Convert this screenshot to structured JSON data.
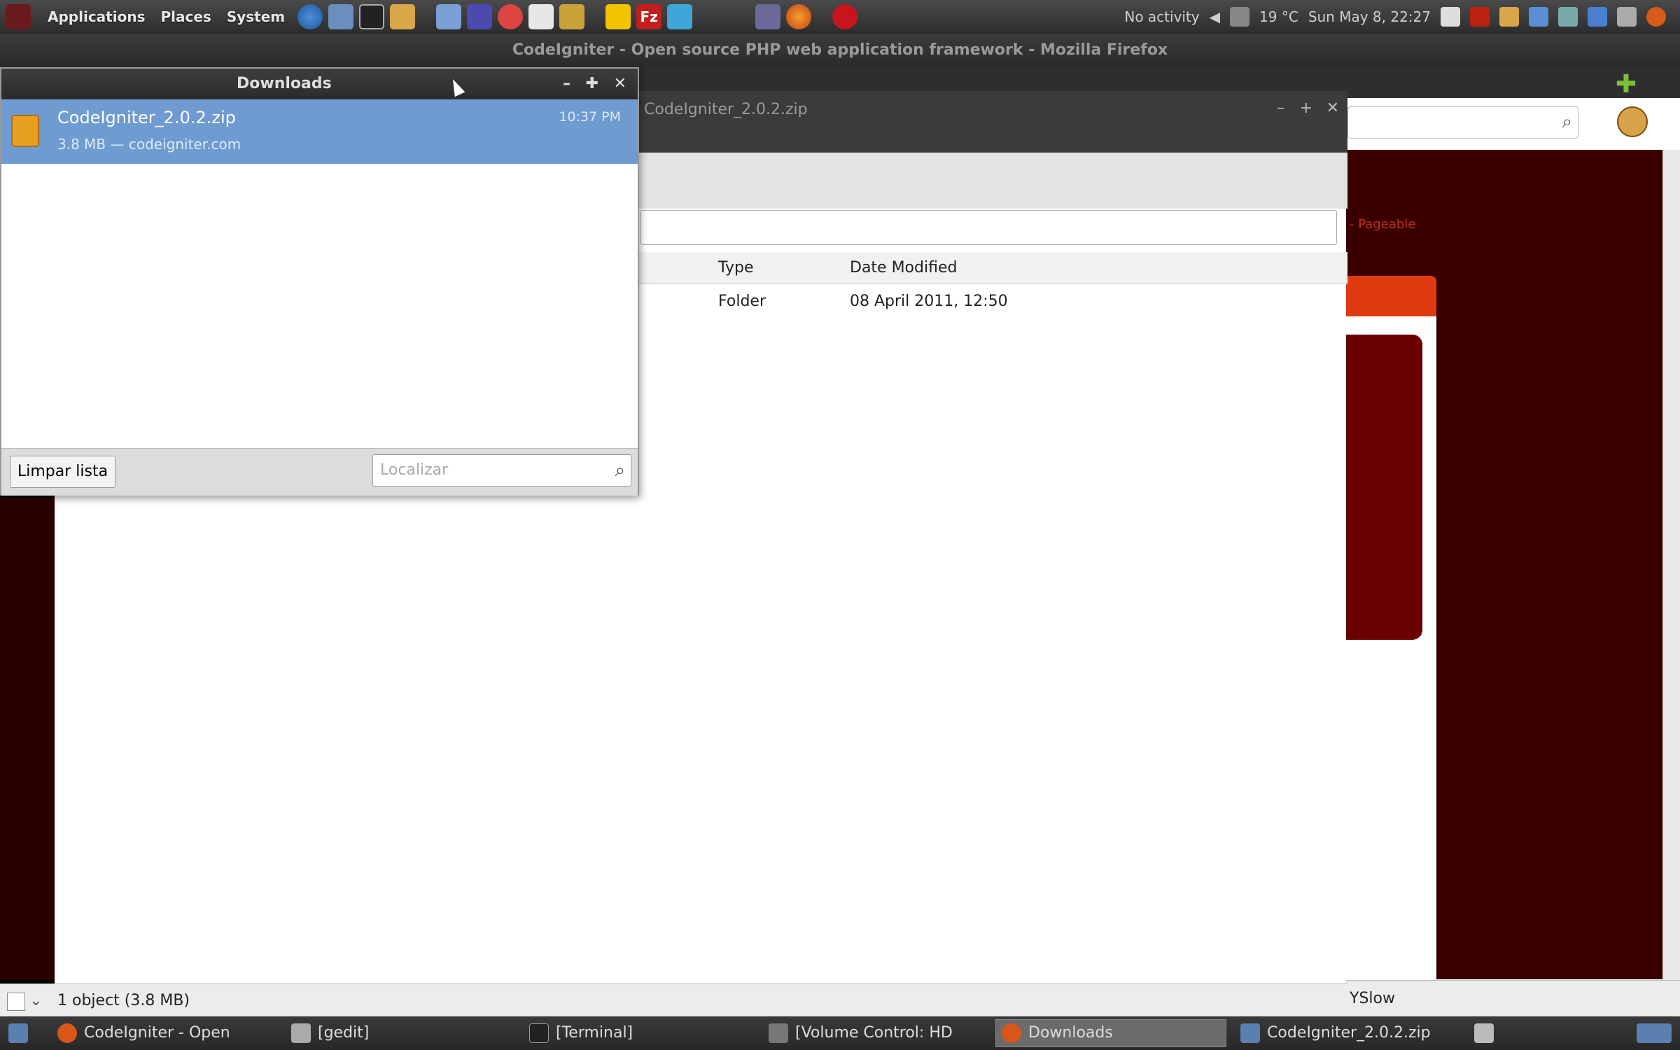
{
  "top_panel": {
    "menus": [
      "Applications",
      "Places",
      "System"
    ],
    "status_text": "No activity",
    "weather": "19 °C",
    "clock": "Sun May  8, 22:27"
  },
  "firefox": {
    "window_title": "CodeIgniter - Open source PHP web application framework - Mozilla Firefox",
    "site_nav": "- Pageable",
    "status_addon": "YSlow"
  },
  "archive_window": {
    "title": "CodeIgniter_2.0.2.zip",
    "columns": [
      "Type",
      "Date Modified"
    ],
    "rows": [
      {
        "type": "Folder",
        "date": "08 April 2011, 12:50"
      }
    ],
    "status": "1 object (3.8 MB)"
  },
  "downloads": {
    "title": "Downloads",
    "item_name": "CodeIgniter_2.0.2.zip",
    "item_info": "3.8 MB — codeigniter.com",
    "item_time": "10:37 PM",
    "clear_label": "Limpar lista",
    "search_placeholder": "Localizar"
  },
  "taskbar": {
    "items": [
      {
        "label": "CodeIgniter - Open",
        "active": false
      },
      {
        "label": "[gedit]",
        "active": false
      },
      {
        "label": "[Terminal]",
        "active": false
      },
      {
        "label": "[Volume Control: HD",
        "active": false
      },
      {
        "label": "Downloads",
        "active": true
      },
      {
        "label": "CodeIgniter_2.0.2.zip",
        "active": false
      }
    ]
  },
  "colors": {
    "selection": "#6e9bd0",
    "site_dark": "#3a0000",
    "site_accent": "#e03a10"
  }
}
